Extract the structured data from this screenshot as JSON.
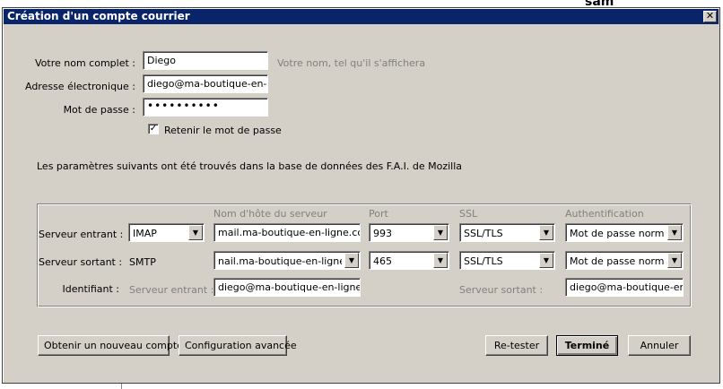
{
  "window": {
    "title": "Création d'un compte courrier",
    "close_glyph": "✕"
  },
  "background": {
    "peek_text": "sam"
  },
  "form": {
    "fullname_label": "Votre nom complet :",
    "fullname_value": "Diego",
    "fullname_hint": "Votre nom, tel qu'il s'affichera",
    "email_label": "Adresse électronique :",
    "email_value": "diego@ma-boutique-en-ligne.com",
    "password_label": "Mot de passe :",
    "password_value": "••••••••••",
    "remember_label": "Retenir le mot de passe",
    "remember_checked": "✓"
  },
  "info_text": "Les paramètres suivants ont été trouvés dans la base de données des F.A.I. de Mozilla",
  "server": {
    "headers": {
      "hostname": "Nom d'hôte du serveur",
      "port": "Port",
      "ssl": "SSL",
      "auth": "Authentification"
    },
    "incoming": {
      "label": "Serveur entrant :",
      "protocol": "IMAP",
      "hostname": "mail.ma-boutique-en-ligne.com",
      "port": "993",
      "ssl": "SSL/TLS",
      "auth": "Mot de passe normal"
    },
    "outgoing": {
      "label": "Serveur sortant :",
      "protocol": "SMTP",
      "hostname": "nail.ma-boutique-en-ligne.com",
      "port": "465",
      "ssl": "SSL/TLS",
      "auth": "Mot de passe normal"
    },
    "identity": {
      "label": "Identifiant :",
      "incoming_label": "Serveur entrant :",
      "incoming_value": "diego@ma-boutique-en-ligne.co",
      "outgoing_label": "Serveur sortant :",
      "outgoing_value": "diego@ma-boutique-en-lig"
    }
  },
  "buttons": {
    "new_account": "Obtenir un nouveau compte",
    "advanced": "Configuration avancée",
    "retest": "Re-tester",
    "done": "Terminé",
    "cancel": "Annuler"
  },
  "icons": {
    "dropdown": "▼"
  }
}
